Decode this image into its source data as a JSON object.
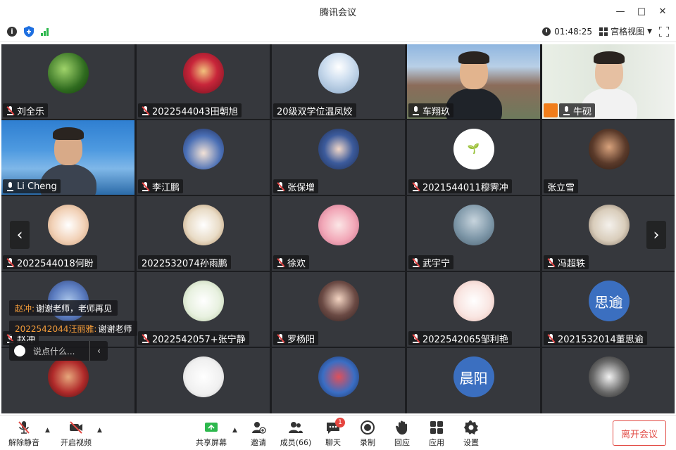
{
  "window": {
    "title": "腾讯会议"
  },
  "infobar": {
    "timer": "01:48:25",
    "view_label": "宫格视图"
  },
  "tiles": [
    {
      "name": "刘全乐",
      "avatar": "bamboo",
      "muted": true
    },
    {
      "name": "2022544043田朝旭",
      "avatar": "ironman",
      "muted": true
    },
    {
      "name": "20级双学位温凤姣",
      "avatar": "sky",
      "muted": false,
      "nomic": true
    },
    {
      "name": "车翔玖",
      "video": true,
      "muted": false
    },
    {
      "name": "牛砚",
      "video": true,
      "muted": false,
      "host": true,
      "active": true
    },
    {
      "name": "Li Cheng",
      "video": true,
      "muted": false
    },
    {
      "name": "李江鹏",
      "avatar": "anime-hat",
      "muted": true
    },
    {
      "name": "张保增",
      "avatar": "anime-blue",
      "muted": true
    },
    {
      "name": "2021544011穆霁冲",
      "avatar": "sprout",
      "muted": true
    },
    {
      "name": "张立雪",
      "avatar": "portrait",
      "muted": false,
      "nomic": true
    },
    {
      "name": "2022544018何盼",
      "avatar": "cat",
      "muted": true
    },
    {
      "name": "2022532074孙雨鹏",
      "avatar": "box",
      "muted": false,
      "nomic": true
    },
    {
      "name": "徐欢",
      "avatar": "baby",
      "muted": true
    },
    {
      "name": "武宇宁",
      "avatar": "sea",
      "muted": true
    },
    {
      "name": "冯超轶",
      "avatar": "boy-sketch",
      "muted": true
    },
    {
      "name": "赵冲",
      "avatar": "tom",
      "muted": true
    },
    {
      "name": "2022542057+张宁静",
      "avatar": "cloud",
      "muted": true
    },
    {
      "name": "罗杨阳",
      "avatar": "girl",
      "muted": true
    },
    {
      "name": "2022542065邹利艳",
      "avatar": "bunny",
      "muted": true
    },
    {
      "name": "2021532014董思逾",
      "avatar_text": "思逾",
      "muted": true
    },
    {
      "name": "",
      "avatar": "basketball",
      "muted": true
    },
    {
      "name": "",
      "avatar": "sketch",
      "muted": true
    },
    {
      "name": "",
      "avatar": "shark",
      "muted": true
    },
    {
      "name": "",
      "avatar_text": "晨阳",
      "muted": true
    },
    {
      "name": "",
      "avatar": "dark",
      "muted": true
    }
  ],
  "chat": {
    "messages": [
      {
        "who": "赵冲:",
        "text": "谢谢老师，老师再见"
      },
      {
        "who": "2022542044汪丽雅:",
        "text": "谢谢老师"
      }
    ],
    "placeholder": "说点什么..."
  },
  "toolbar": {
    "unmute": "解除静音",
    "video": "开启视频",
    "share": "共享屏幕",
    "invite": "邀请",
    "members": "成员(66)",
    "chat": "聊天",
    "chat_badge": "1",
    "record": "录制",
    "reaction": "回应",
    "apps": "应用",
    "settings": "设置",
    "leave": "离开会议"
  },
  "colors": {
    "accent_green": "#2db84d",
    "leave_red": "#e24b45",
    "host_orange": "#f07d1a"
  }
}
